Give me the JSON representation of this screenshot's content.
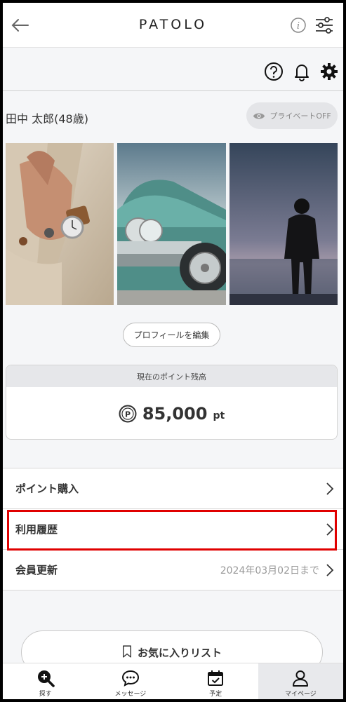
{
  "header": {
    "brand": "PATOLO",
    "back_icon": "arrow-left-icon",
    "info_icon": "info-icon",
    "filter_icon": "sliders-icon"
  },
  "actions": {
    "help_icon": "question-circle-icon",
    "bell_icon": "bell-icon",
    "settings_icon": "gear-icon"
  },
  "profile": {
    "name": "田中 太郎(48歳)",
    "private_toggle": "プライベートOFF",
    "edit_button": "プロフィールを編集"
  },
  "points": {
    "header": "現在のポイント残高",
    "value": "85,000",
    "unit": "pt"
  },
  "menu": {
    "items": [
      {
        "label": "ポイント購入",
        "sub": ""
      },
      {
        "label": "利用履歴",
        "sub": ""
      },
      {
        "label": "会員更新",
        "sub": "2024年03月02日まで"
      }
    ]
  },
  "favorites": {
    "label": "お気に入りリスト"
  },
  "tabs": [
    {
      "label": "探す",
      "icon": "search-plus-icon"
    },
    {
      "label": "メッセージ",
      "icon": "chat-bubble-icon"
    },
    {
      "label": "予定",
      "icon": "calendar-check-icon"
    },
    {
      "label": "マイページ",
      "icon": "user-icon"
    }
  ],
  "colors": {
    "highlight": "#e00000",
    "accent": "#222222"
  }
}
